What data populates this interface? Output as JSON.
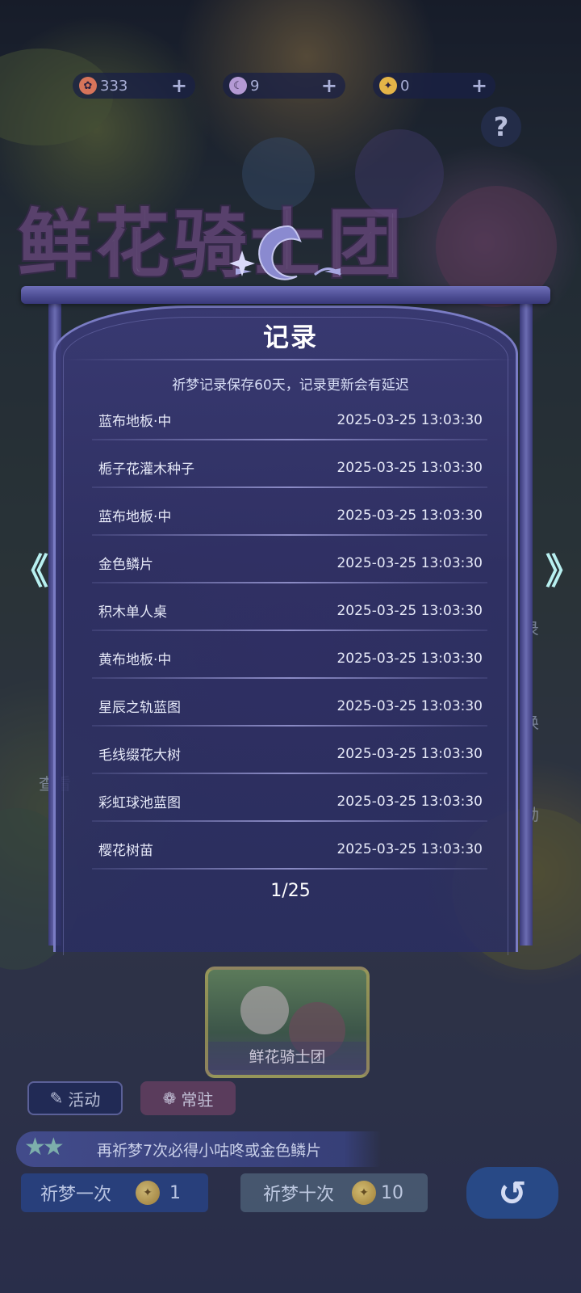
{
  "currencies": [
    {
      "icon": "flower-coin-icon",
      "value": "333",
      "plus": "+"
    },
    {
      "icon": "moon-icon",
      "value": "9",
      "plus": "+"
    },
    {
      "icon": "gold-scale-icon",
      "value": "0",
      "plus": "+"
    }
  ],
  "help_label": "?",
  "background_title": "鲜花骑士团",
  "side_labels": {
    "record": "录",
    "exchange": "换",
    "reward": "励",
    "view": "查看"
  },
  "dialog": {
    "title": "记录",
    "notice": "祈梦记录保存60天，记录更新会有延迟",
    "records": [
      {
        "name": "蓝布地板·中",
        "time": "2025-03-25 13:03:30"
      },
      {
        "name": "栀子花灌木种子",
        "time": "2025-03-25 13:03:30"
      },
      {
        "name": "蓝布地板·中",
        "time": "2025-03-25 13:03:30"
      },
      {
        "name": "金色鳞片",
        "time": "2025-03-25 13:03:30"
      },
      {
        "name": "积木单人桌",
        "time": "2025-03-25 13:03:30"
      },
      {
        "name": "黄布地板·中",
        "time": "2025-03-25 13:03:30"
      },
      {
        "name": "星辰之轨蓝图",
        "time": "2025-03-25 13:03:30"
      },
      {
        "name": "毛线缀花大树",
        "time": "2025-03-25 13:03:30"
      },
      {
        "name": "彩虹球池蓝图",
        "time": "2025-03-25 13:03:30"
      },
      {
        "name": "樱花树苗",
        "time": "2025-03-25 13:03:30"
      }
    ],
    "pager": "1/25",
    "prev_arrow": "《",
    "next_arrow": "》"
  },
  "bottom": {
    "pool_card_label": "鲜花骑士团",
    "tabs": [
      {
        "label": "活动"
      },
      {
        "label": "常驻"
      }
    ],
    "banner": "再祈梦7次必得小咕咚或金色鳞片",
    "pray_once": {
      "label": "祈梦一次",
      "cost": "1"
    },
    "pray_ten": {
      "label": "祈梦十次",
      "cost": "10"
    },
    "back_symbol": "↺"
  },
  "colors": {
    "panel": "#34346e",
    "frame": "#6e6fb8",
    "text": "#e6e9f8",
    "arrow": "#b8f0f0"
  }
}
